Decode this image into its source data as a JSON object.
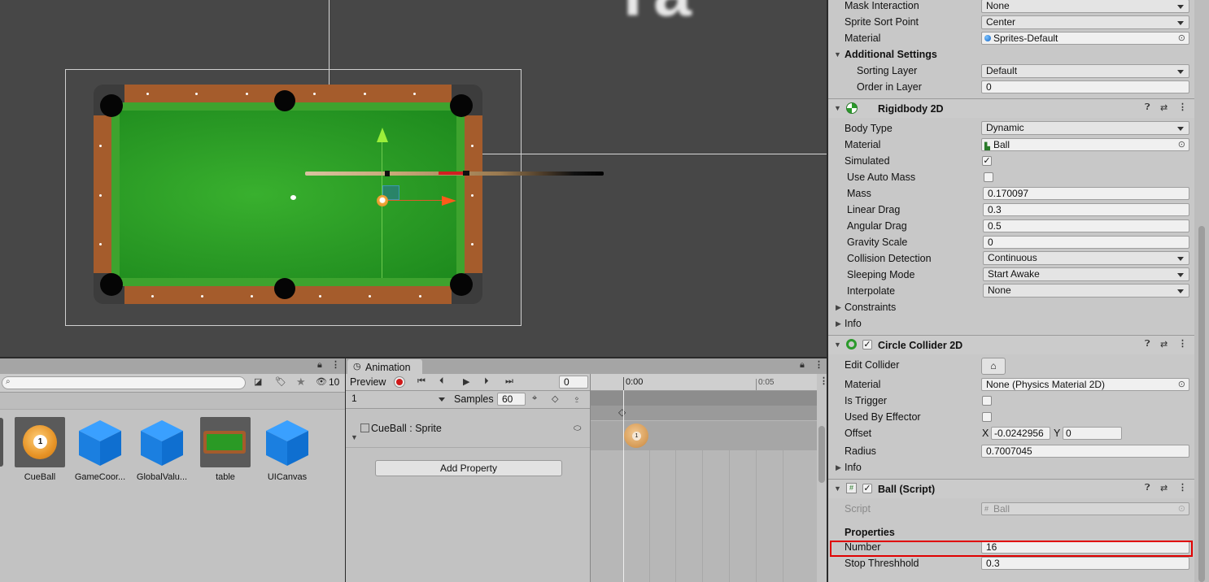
{
  "scene": {
    "background_text": "Ta"
  },
  "project": {
    "search": {
      "placeholder": ""
    },
    "hidden_count": "10",
    "assets": [
      {
        "label": "CueBall",
        "type": "ball",
        "ball_number": "1"
      },
      {
        "label": "GameCoor...",
        "type": "cube"
      },
      {
        "label": "GlobalValu...",
        "type": "cube"
      },
      {
        "label": "table",
        "type": "table"
      },
      {
        "label": "UICanvas",
        "type": "cube"
      }
    ]
  },
  "animation": {
    "tab_label": "Animation",
    "preview_label": "Preview",
    "frame_value": "0",
    "clip_value": "1",
    "samples_label": "Samples",
    "samples_value": "60",
    "track_label": "CueBall : Sprite",
    "add_property_label": "Add Property",
    "time_0": "0:00",
    "time_1": "0:05",
    "key_ball_number": "1"
  },
  "inspector": {
    "sprite_renderer": {
      "mask_interaction": {
        "label": "Mask Interaction",
        "value": "None"
      },
      "sprite_sort_point": {
        "label": "Sprite Sort Point",
        "value": "Center"
      },
      "material": {
        "label": "Material",
        "value": "Sprites-Default"
      },
      "additional_settings": "Additional Settings",
      "sorting_layer": {
        "label": "Sorting Layer",
        "value": "Default"
      },
      "order_in_layer": {
        "label": "Order in Layer",
        "value": "0"
      }
    },
    "rigidbody": {
      "title": "Rigidbody 2D",
      "body_type": {
        "label": "Body Type",
        "value": "Dynamic"
      },
      "material": {
        "label": "Material",
        "value": "Ball"
      },
      "simulated": {
        "label": "Simulated",
        "checked": true
      },
      "use_auto_mass": {
        "label": "Use Auto Mass",
        "checked": false
      },
      "mass": {
        "label": "Mass",
        "value": "0.170097"
      },
      "linear_drag": {
        "label": "Linear Drag",
        "value": "0.3"
      },
      "angular_drag": {
        "label": "Angular Drag",
        "value": "0.5"
      },
      "gravity_scale": {
        "label": "Gravity Scale",
        "value": "0"
      },
      "collision_detection": {
        "label": "Collision Detection",
        "value": "Continuous"
      },
      "sleeping_mode": {
        "label": "Sleeping Mode",
        "value": "Start Awake"
      },
      "interpolate": {
        "label": "Interpolate",
        "value": "None"
      },
      "constraints": "Constraints",
      "info": "Info"
    },
    "circle_collider": {
      "title": "Circle Collider 2D",
      "edit_collider": "Edit Collider",
      "material": {
        "label": "Material",
        "value": "None (Physics Material 2D)"
      },
      "is_trigger": {
        "label": "Is Trigger",
        "checked": false
      },
      "used_by_effector": {
        "label": "Used By Effector",
        "checked": false
      },
      "offset": {
        "label": "Offset",
        "x_label": "X",
        "x": "-0.0242956",
        "y_label": "Y",
        "y": "0"
      },
      "radius": {
        "label": "Radius",
        "value": "0.7007045"
      },
      "info": "Info"
    },
    "ball_script": {
      "title": "Ball (Script)",
      "script": {
        "label": "Script",
        "value": "Ball"
      },
      "properties": "Properties",
      "number": {
        "label": "Number",
        "value": "16"
      },
      "stop_threshold": {
        "label": "Stop Threshhold",
        "value": "0.3"
      }
    },
    "highlight_color": "#e00000"
  }
}
